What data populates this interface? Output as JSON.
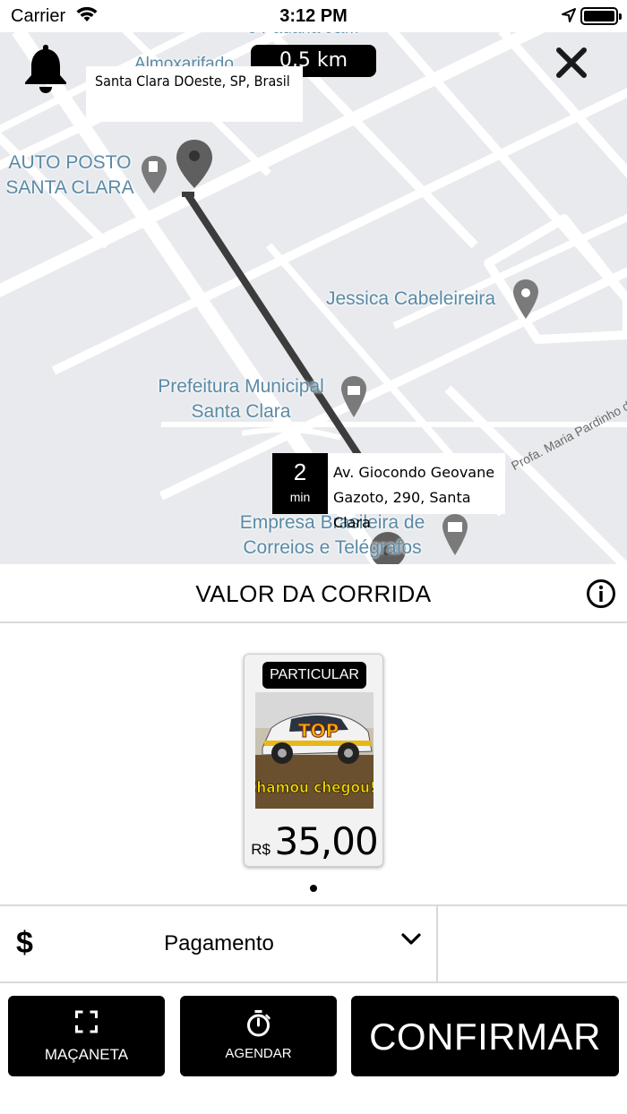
{
  "status_bar": {
    "carrier": "Carrier",
    "time": "3:12 PM"
  },
  "map": {
    "distance": "0,5 km",
    "origin_address": "Santa Clara DOeste, SP, Brasil",
    "eta_value": "2",
    "eta_unit": "min",
    "destination_line1": "Av. Giocondo Geovane",
    "destination_line2": "Gazoto, 290, Santa Clara",
    "places": {
      "auto_posto_1": "AUTO POSTO",
      "auto_posto_2": "SANTA CLARA",
      "jessica": "Jessica Cabeleireira",
      "prefeitura_1": "Prefeitura Municipal",
      "prefeitura_2": "Santa Clara",
      "correios_1": "Empresa Brasileira de",
      "correios_2": "Correios e Telégrafos",
      "top_partial_1": "e Padaria J&M",
      "top_partial_2": "Almoxarifado",
      "street": "Profa. Maria Pardinho de"
    }
  },
  "panel": {
    "title": "VALOR DA CORRIDA",
    "vehicle": {
      "category": "PARTICULAR",
      "photo_text": "Chamou chegou!!",
      "photo_logo": "TOP",
      "currency": "R$",
      "price": "35,00"
    },
    "payment_label": "Pagamento",
    "buttons": {
      "macaneta": "MAÇANETA",
      "agendar": "AGENDAR",
      "confirmar": "CONFIRMAR"
    }
  },
  "colors": {
    "accent": "#000000",
    "map_bg": "#e8eaed",
    "map_road": "#ffffff",
    "route": "#3c3c3c",
    "poi_label": "#5a8aa6"
  },
  "icons": [
    "wifi-icon",
    "location-arrow-icon",
    "battery-icon",
    "bell-icon",
    "close-icon",
    "map-pin-icon",
    "info-icon",
    "dollar-icon",
    "chevron-down-icon",
    "expand-icon",
    "stopwatch-icon"
  ]
}
